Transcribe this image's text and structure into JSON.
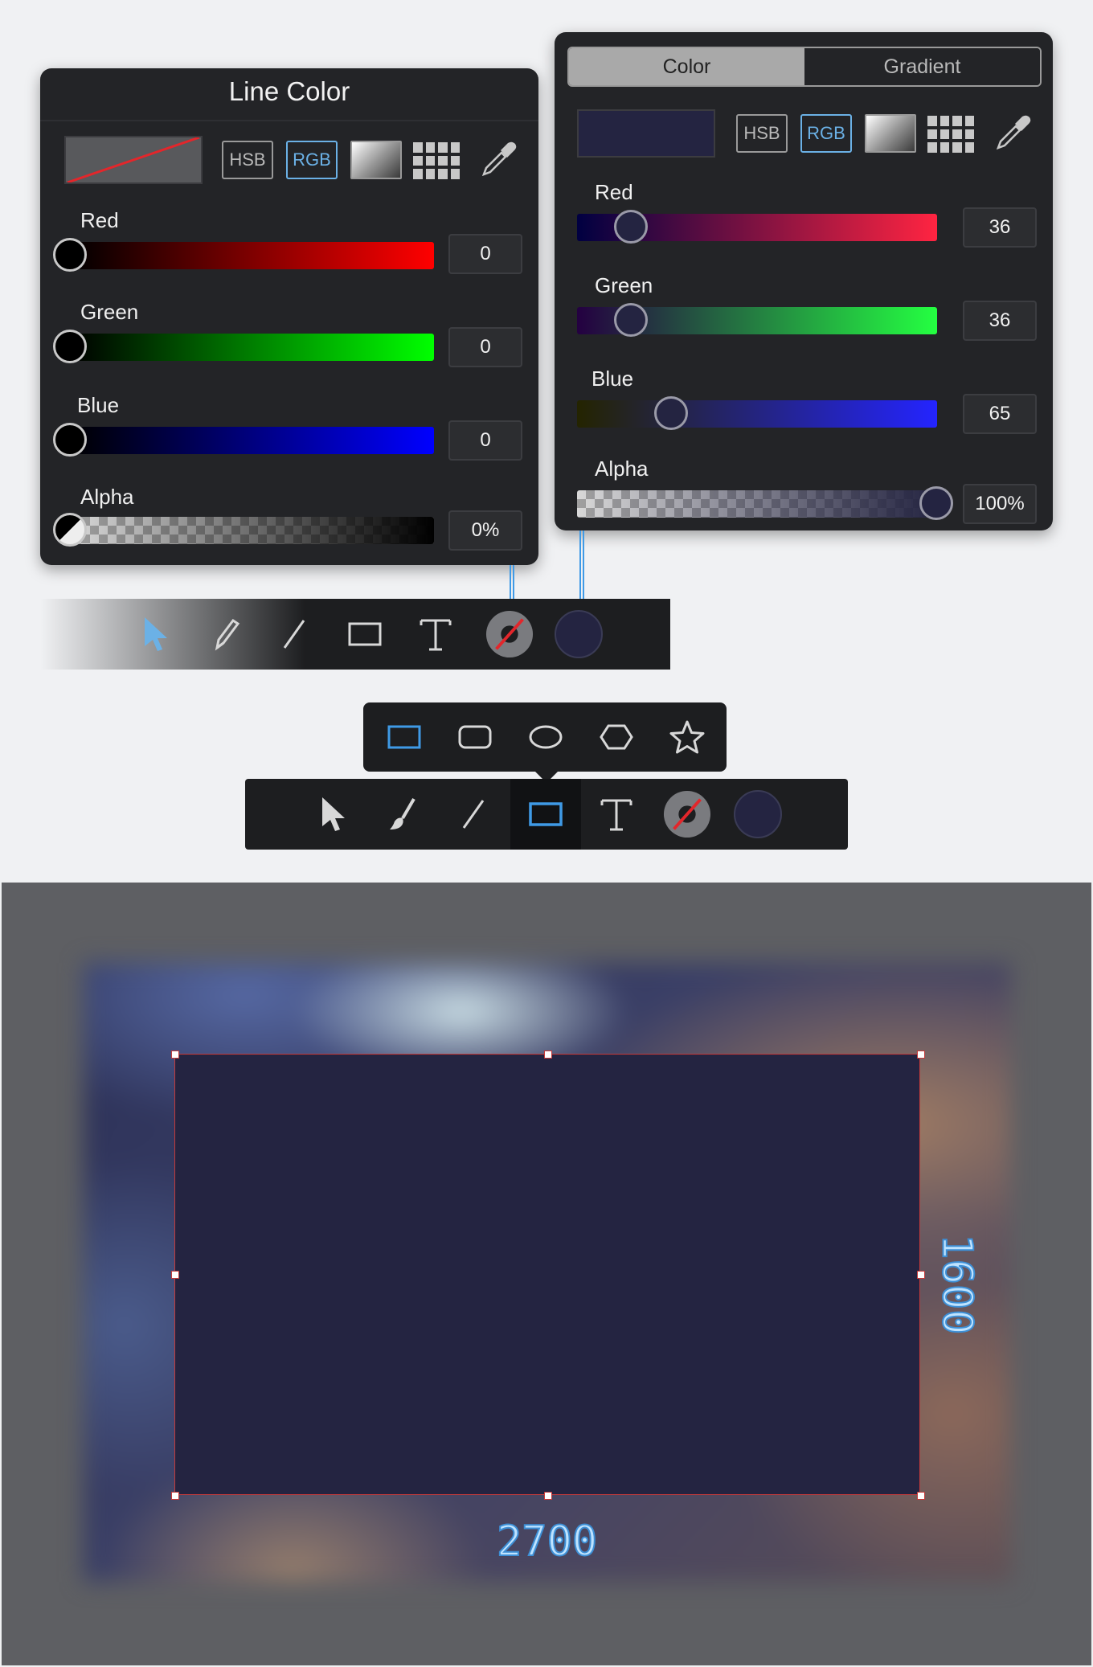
{
  "line_color_panel": {
    "title": "Line Color",
    "modes": [
      "HSB",
      "RGB"
    ],
    "active_mode": "RGB",
    "channels": [
      {
        "label": "Red",
        "value": "0",
        "level": 0
      },
      {
        "label": "Green",
        "value": "0",
        "level": 0
      },
      {
        "label": "Blue",
        "value": "0",
        "level": 0
      },
      {
        "label": "Alpha",
        "value": "0%",
        "level": 0
      }
    ]
  },
  "fill_color_panel": {
    "tabs": [
      "Color",
      "Gradient"
    ],
    "active_tab": "Color",
    "modes": [
      "HSB",
      "RGB"
    ],
    "active_mode": "RGB",
    "swatch_color": "#242441",
    "channels": [
      {
        "label": "Red",
        "value": "36",
        "level": 0.141
      },
      {
        "label": "Green",
        "value": "36",
        "level": 0.141
      },
      {
        "label": "Blue",
        "value": "65",
        "level": 0.255
      },
      {
        "label": "Alpha",
        "value": "100%",
        "level": 1.0
      }
    ]
  },
  "toolbar_top": {
    "tools": [
      "select-tool",
      "pencil-tool",
      "line-tool",
      "rectangle-tool",
      "text-tool",
      "line-color-tool",
      "fill-color-tool"
    ],
    "active_tool": "select-tool"
  },
  "shape_popup": {
    "shapes": [
      "rectangle",
      "rounded-rectangle",
      "ellipse",
      "hexagon",
      "star"
    ],
    "selected_shape": "rectangle"
  },
  "toolbar_bottom": {
    "tools": [
      "select-tool",
      "brush-tool",
      "line-tool",
      "rectangle-tool",
      "text-tool",
      "line-color-tool",
      "fill-color-tool"
    ],
    "active_tool": "rectangle-tool"
  },
  "canvas": {
    "shape_fill": "#242441",
    "width_label": "2700",
    "height_label": "1600"
  },
  "colors": {
    "accent": "#3f9ae6",
    "panel_bg": "#232427",
    "toolbar_bg": "#1d1e20",
    "canvas_bg": "#5e5f63"
  }
}
